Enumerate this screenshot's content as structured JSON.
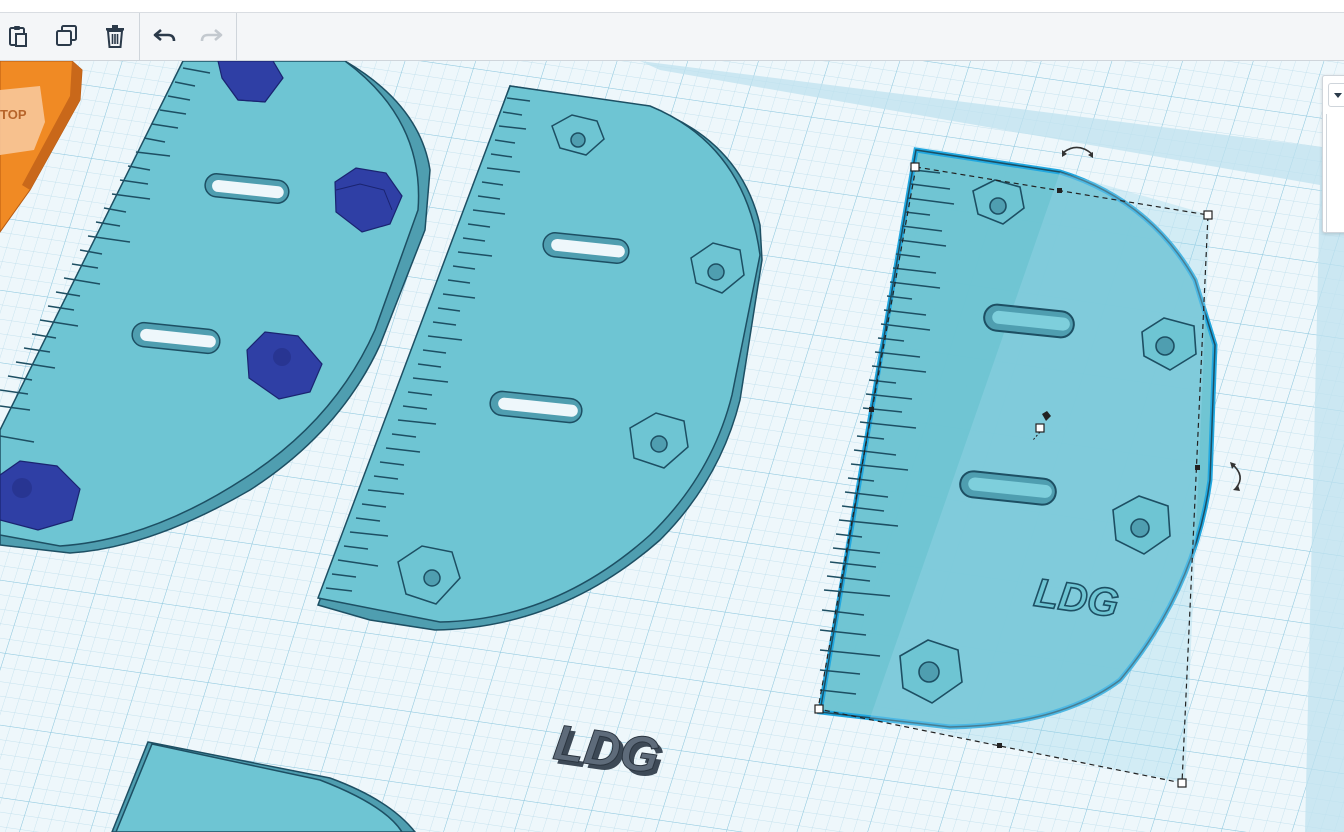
{
  "toolbar": {
    "buttons": [
      {
        "name": "paste",
        "icon": "clipboard-icon"
      },
      {
        "name": "duplicate",
        "icon": "duplicate-icon"
      },
      {
        "name": "delete",
        "icon": "trash-icon"
      },
      {
        "name": "undo",
        "icon": "undo-arrow-icon"
      },
      {
        "name": "redo",
        "icon": "redo-arrow-icon",
        "disabled": true
      }
    ]
  },
  "workplane": {
    "labels": {
      "view_cube_face": "TOP",
      "plate_engraving": "LDG",
      "standalone_text": "LDG"
    }
  },
  "colors": {
    "workplane": "#eef7fb",
    "grid_line": "#b9dcea",
    "grid_major": "#8ec8df",
    "plate": "#6ec5d3",
    "plate_side": "#4f9eb0",
    "plate_edge": "#1d4f63",
    "selection": "#1ea7e0",
    "nut": "#2f3fa5",
    "view_cube": "#f08a24",
    "text_shape": "#5e6b7a"
  }
}
